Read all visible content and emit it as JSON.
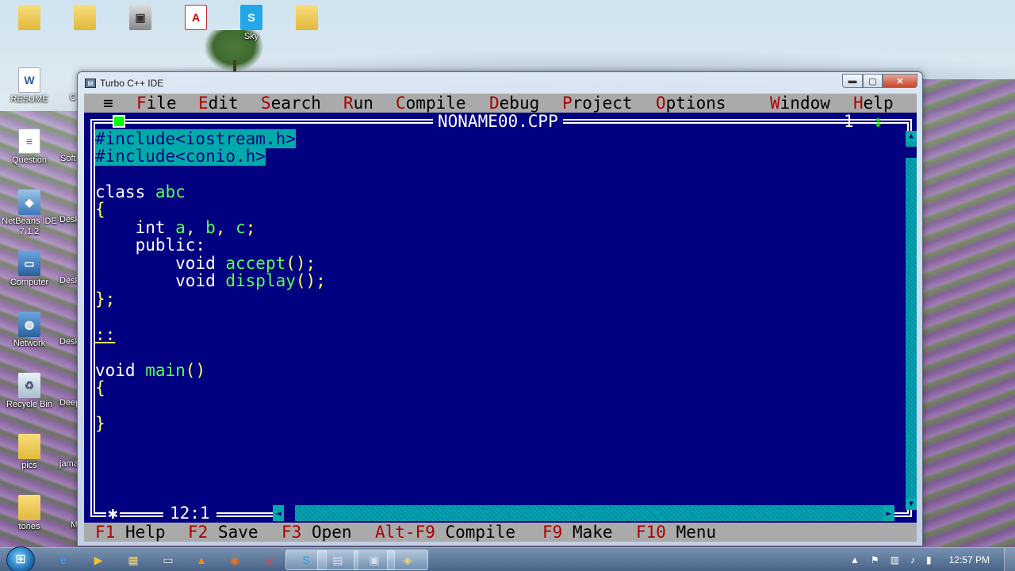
{
  "desktop": {
    "top_icons": [
      "",
      "",
      "",
      "",
      "Sky",
      ""
    ],
    "left_icons": [
      {
        "label": "RESUME",
        "icon": "word-doc-icon"
      },
      {
        "label": "Question",
        "icon": "document-icon"
      },
      {
        "label": "NetBeans IDE\n7.1.2",
        "icon": "netbeans-icon"
      },
      {
        "label": "Computer",
        "icon": "computer-icon"
      },
      {
        "label": "Network",
        "icon": "network-icon"
      },
      {
        "label": "Recycle Bin",
        "icon": "recycle-bin-icon"
      },
      {
        "label": "pics",
        "icon": "folder-icon"
      },
      {
        "label": "tones",
        "icon": "folder-icon"
      }
    ],
    "second_column_cut": [
      "C",
      "Soft",
      "Desk",
      "Desk",
      "Desk",
      "Deep",
      "jama",
      "M"
    ]
  },
  "window": {
    "title": "Turbo C++ IDE",
    "minimize_glyph": "▬",
    "maximize_glyph": "▢",
    "close_glyph": "✕"
  },
  "menu": {
    "system": "≡",
    "items": [
      {
        "hot": "F",
        "rest": "ile"
      },
      {
        "hot": "E",
        "rest": "dit"
      },
      {
        "hot": "S",
        "rest": "earch"
      },
      {
        "hot": "R",
        "rest": "un"
      },
      {
        "hot": "C",
        "rest": "ompile"
      },
      {
        "hot": "D",
        "rest": "ebug"
      },
      {
        "hot": "P",
        "rest": "roject"
      },
      {
        "hot": "O",
        "rest": "ptions"
      },
      {
        "hot": "W",
        "rest": "indow"
      },
      {
        "hot": "H",
        "rest": "elp"
      }
    ]
  },
  "editor": {
    "filename": "NONAME00.CPP",
    "window_number": "1",
    "resize_glyph": "↕",
    "cursor_pos": "12:1",
    "code": {
      "l1": "#include<iostream.h>",
      "l2": "#include<conio.h>",
      "l4a": "class ",
      "l4b": "abc",
      "l5": "{",
      "l6a": "    int ",
      "l6b": "a",
      "l6c": ", ",
      "l6d": "b",
      "l6e": ", ",
      "l6f": "c",
      "l6g": ";",
      "l7": "    public:",
      "l8a": "        void ",
      "l8b": "accept",
      "l8c": "();",
      "l9a": "        void ",
      "l9b": "display",
      "l9c": "();",
      "l10": "};",
      "l12": "::",
      "l14a": "void ",
      "l14b": "main",
      "l14c": "()",
      "l15": "{",
      "l17": "}"
    }
  },
  "statusbar": {
    "keys": [
      {
        "key": "F1",
        "label": " Help"
      },
      {
        "key": "F2",
        "label": " Save"
      },
      {
        "key": "F3",
        "label": " Open"
      },
      {
        "key": "Alt-F9",
        "label": " Compile"
      },
      {
        "key": "F9",
        "label": " Make"
      },
      {
        "key": "F10",
        "label": " Menu"
      }
    ]
  },
  "taskbar": {
    "clock": "12:57 PM"
  }
}
